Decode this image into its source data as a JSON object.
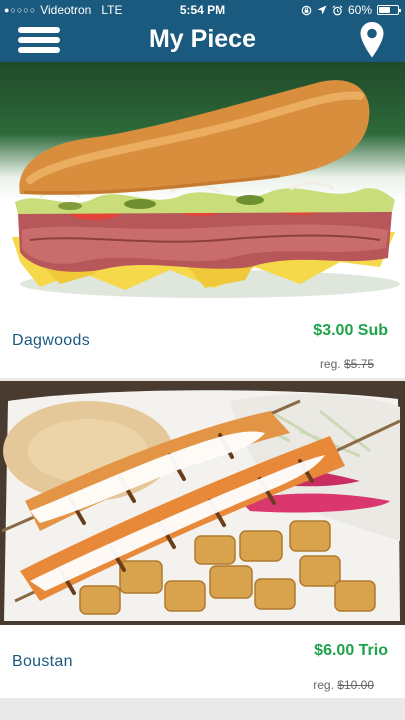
{
  "status_bar": {
    "signal_dots": "●○○○○",
    "carrier": "Videotron",
    "network": "LTE",
    "time": "5:54 PM",
    "battery_percent": "60%",
    "battery_level": 0.6
  },
  "header": {
    "title": "My Piece",
    "menu_icon": "hamburger-menu-icon",
    "location_icon": "map-pin-icon"
  },
  "colors": {
    "header_bg": "#1a5a7e",
    "name_color": "#1a5a7e",
    "price_color": "#1fa34a"
  },
  "items": [
    {
      "name": "Dagwoods",
      "price": "$3.00 Sub",
      "reg_label": "reg.",
      "reg_price": "$5.75",
      "image": "submarine-sandwich-photo"
    },
    {
      "name": "Boustan",
      "price": "$6.00 Trio",
      "reg_label": "reg.",
      "reg_price": "$10.00",
      "image": "chicken-shish-taouk-plate-photo"
    }
  ]
}
